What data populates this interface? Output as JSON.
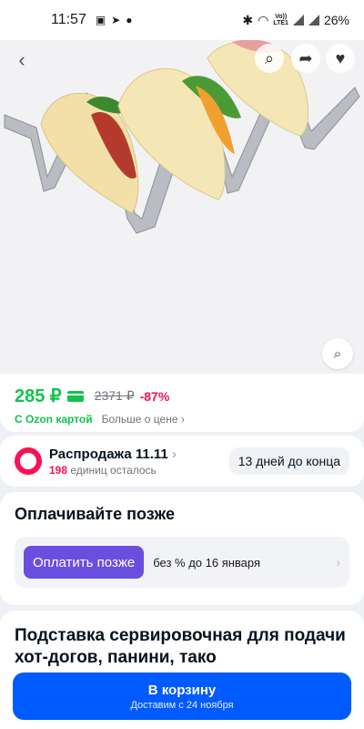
{
  "status_bar": {
    "time": "11:57",
    "notification_icons": [
      "image-icon",
      "telegram-icon",
      "dot-icon"
    ],
    "lte_top": "Vo))",
    "lte_bottom": "LTE1",
    "battery": "26%"
  },
  "product_image": {
    "icons": [
      "back-arrow-icon",
      "search-icon",
      "share-icon",
      "heart-icon",
      "similar-search-icon"
    ]
  },
  "price_block": {
    "price": "285 ₽",
    "old_price": "2371 ₽",
    "discount": "-87%",
    "card_label": "С Ozon картой",
    "more_price": "Больше о цене",
    "colors": {
      "price_green": "#10c44c",
      "discount_pink": "#f91155"
    }
  },
  "sale_block": {
    "title": "Распродажа 11.11",
    "units_count": "198",
    "units_text": "единиц осталось",
    "days_left": "13 дней до конца"
  },
  "pay_later_block": {
    "title": "Оплачивайте позже",
    "button": "Оплатить позже",
    "terms": "без % до 16 января",
    "button_color": "#6a4ee0"
  },
  "product_title": "Подставка сервировочная для подачи хот-догов, панини, тако",
  "cart_button": {
    "label": "В корзину",
    "delivery": "Доставим с 24 ноября",
    "color": "#005bff"
  }
}
